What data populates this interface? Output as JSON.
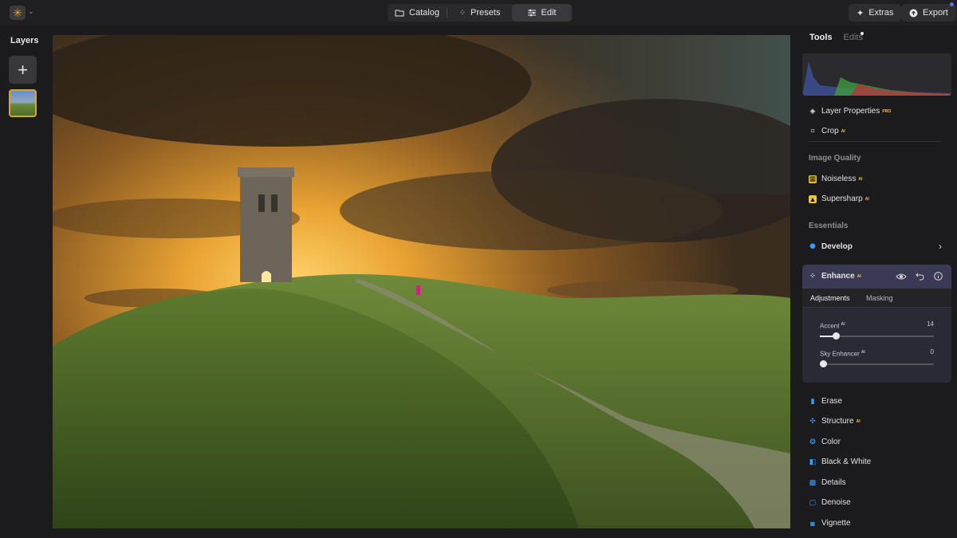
{
  "topbar": {
    "catalog_label": "Catalog",
    "presets_label": "Presets",
    "edit_label": "Edit",
    "extras_label": "Extras",
    "export_label": "Export"
  },
  "layers": {
    "title": "Layers"
  },
  "panel": {
    "tab_tools": "Tools",
    "tab_edits": "Edits",
    "layer_properties": "Layer Properties",
    "layer_properties_badge": "PRO",
    "crop": "Crop",
    "ai_badge": "AI",
    "image_quality_header": "Image Quality",
    "noiseless": "Noiseless",
    "supersharp": "Supersharp",
    "essentials_header": "Essentials",
    "develop": "Develop",
    "enhance": {
      "title": "Enhance",
      "tab_adjustments": "Adjustments",
      "tab_masking": "Masking",
      "sliders": [
        {
          "label": "Accent",
          "value": "14",
          "fraction": 0.14
        },
        {
          "label": "Sky Enhancer",
          "value": "0",
          "fraction": 0.0
        }
      ]
    },
    "tools": [
      "Erase",
      "Structure",
      "Color",
      "Black & White",
      "Details",
      "Denoise",
      "Vignette"
    ]
  },
  "colors": {
    "accent_gold": "#f2c340",
    "enhance_header": "#3a3a55",
    "selected_layer_border": "#d8a535"
  }
}
